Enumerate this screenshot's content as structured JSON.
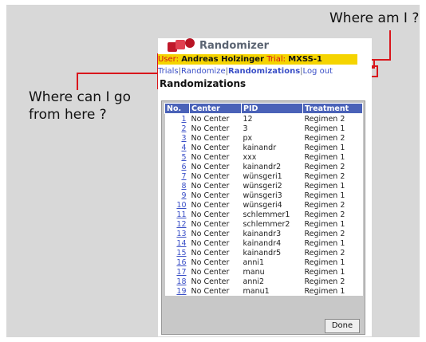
{
  "annotations": {
    "where_am_i": "Where am I ?",
    "where_can_i_go": "Where can I go from here ?"
  },
  "colors": {
    "highlight_red": "#d9161c",
    "header_blue": "#4a62b8",
    "user_bar_yellow": "#f5d400"
  },
  "app": {
    "title": "Randomizer",
    "logo_icon": "dice-icon",
    "user_label": "User:",
    "user_name": "Andreas Holzinger",
    "trial_label": "Trial:",
    "trial_name": "MXSS-1",
    "nav": {
      "trials": "Trials",
      "randomize": "Randomize",
      "randomizations": "Randomizations",
      "logout": "Log out",
      "separator": "|"
    },
    "page_title": "Randomizations",
    "table": {
      "headers": [
        "No.",
        "Center",
        "PID",
        "Treatment"
      ],
      "rows": [
        [
          "1",
          "No Center",
          "12",
          "Regimen 2"
        ],
        [
          "2",
          "No Center",
          "3",
          "Regimen 1"
        ],
        [
          "3",
          "No Center",
          "px",
          "Regimen 2"
        ],
        [
          "4",
          "No Center",
          "kainandr",
          "Regimen 1"
        ],
        [
          "5",
          "No Center",
          "xxx",
          "Regimen 1"
        ],
        [
          "6",
          "No Center",
          "kainandr2",
          "Regimen 2"
        ],
        [
          "7",
          "No Center",
          "wünsgeri1",
          "Regimen 2"
        ],
        [
          "8",
          "No Center",
          "wünsgeri2",
          "Regimen 1"
        ],
        [
          "9",
          "No Center",
          "wünsgeri3",
          "Regimen 1"
        ],
        [
          "10",
          "No Center",
          "wünsgeri4",
          "Regimen 2"
        ],
        [
          "11",
          "No Center",
          "schlemmer1",
          "Regimen 2"
        ],
        [
          "12",
          "No Center",
          "schlemmer2",
          "Regimen 1"
        ],
        [
          "13",
          "No Center",
          "kainandr3",
          "Regimen 2"
        ],
        [
          "14",
          "No Center",
          "kainandr4",
          "Regimen 1"
        ],
        [
          "15",
          "No Center",
          "kainandr5",
          "Regimen 2"
        ],
        [
          "16",
          "No Center",
          "anni1",
          "Regimen 1"
        ],
        [
          "17",
          "No Center",
          "manu",
          "Regimen 1"
        ],
        [
          "18",
          "No Center",
          "anni2",
          "Regimen 2"
        ],
        [
          "19",
          "No Center",
          "manu1",
          "Regimen 1"
        ]
      ]
    },
    "done_label": "Done"
  }
}
